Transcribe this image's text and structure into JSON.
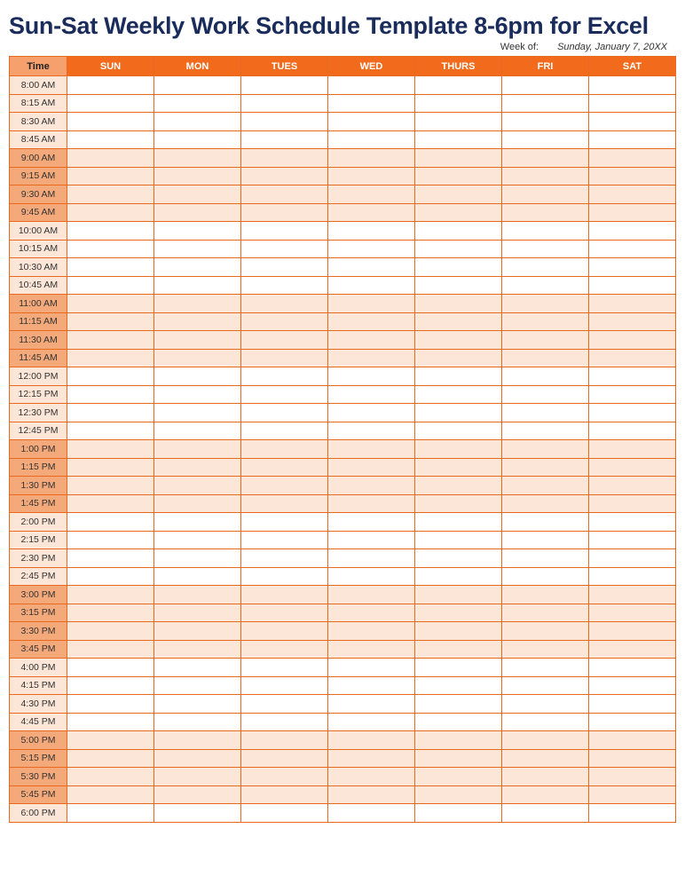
{
  "title": "Sun-Sat Weekly Work Schedule Template 8-6pm for Excel",
  "week_of_label": "Week of:",
  "week_of_value": "Sunday, January 7, 20XX",
  "headers": [
    "Time",
    "SUN",
    "MON",
    "TUES",
    "WED",
    "THURS",
    "FRI",
    "SAT"
  ],
  "rows": [
    {
      "time": "8:00 AM",
      "shade": "A",
      "cells": [
        "",
        "",
        "",
        "",
        "",
        "",
        ""
      ]
    },
    {
      "time": "8:15 AM",
      "shade": "A",
      "cells": [
        "",
        "",
        "",
        "",
        "",
        "",
        ""
      ]
    },
    {
      "time": "8:30 AM",
      "shade": "A",
      "cells": [
        "",
        "",
        "",
        "",
        "",
        "",
        ""
      ]
    },
    {
      "time": "8:45 AM",
      "shade": "A",
      "cells": [
        "",
        "",
        "",
        "",
        "",
        "",
        ""
      ]
    },
    {
      "time": "9:00 AM",
      "shade": "B",
      "cells": [
        "",
        "",
        "",
        "",
        "",
        "",
        ""
      ]
    },
    {
      "time": "9:15 AM",
      "shade": "B",
      "cells": [
        "",
        "",
        "",
        "",
        "",
        "",
        ""
      ]
    },
    {
      "time": "9:30 AM",
      "shade": "B",
      "cells": [
        "",
        "",
        "",
        "",
        "",
        "",
        ""
      ]
    },
    {
      "time": "9:45 AM",
      "shade": "B",
      "cells": [
        "",
        "",
        "",
        "",
        "",
        "",
        ""
      ]
    },
    {
      "time": "10:00 AM",
      "shade": "A",
      "cells": [
        "",
        "",
        "",
        "",
        "",
        "",
        ""
      ]
    },
    {
      "time": "10:15 AM",
      "shade": "A",
      "cells": [
        "",
        "",
        "",
        "",
        "",
        "",
        ""
      ]
    },
    {
      "time": "10:30 AM",
      "shade": "A",
      "cells": [
        "",
        "",
        "",
        "",
        "",
        "",
        ""
      ]
    },
    {
      "time": "10:45 AM",
      "shade": "A",
      "cells": [
        "",
        "",
        "",
        "",
        "",
        "",
        ""
      ]
    },
    {
      "time": "11:00 AM",
      "shade": "B",
      "cells": [
        "",
        "",
        "",
        "",
        "",
        "",
        ""
      ]
    },
    {
      "time": "11:15 AM",
      "shade": "B",
      "cells": [
        "",
        "",
        "",
        "",
        "",
        "",
        ""
      ]
    },
    {
      "time": "11:30 AM",
      "shade": "B",
      "cells": [
        "",
        "",
        "",
        "",
        "",
        "",
        ""
      ]
    },
    {
      "time": "11:45 AM",
      "shade": "B",
      "cells": [
        "",
        "",
        "",
        "",
        "",
        "",
        ""
      ]
    },
    {
      "time": "12:00 PM",
      "shade": "A",
      "cells": [
        "",
        "",
        "",
        "",
        "",
        "",
        ""
      ]
    },
    {
      "time": "12:15 PM",
      "shade": "A",
      "cells": [
        "",
        "",
        "",
        "",
        "",
        "",
        ""
      ]
    },
    {
      "time": "12:30 PM",
      "shade": "A",
      "cells": [
        "",
        "",
        "",
        "",
        "",
        "",
        ""
      ]
    },
    {
      "time": "12:45 PM",
      "shade": "A",
      "cells": [
        "",
        "",
        "",
        "",
        "",
        "",
        ""
      ]
    },
    {
      "time": "1:00 PM",
      "shade": "B",
      "cells": [
        "",
        "",
        "",
        "",
        "",
        "",
        ""
      ]
    },
    {
      "time": "1:15 PM",
      "shade": "B",
      "cells": [
        "",
        "",
        "",
        "",
        "",
        "",
        ""
      ]
    },
    {
      "time": "1:30 PM",
      "shade": "B",
      "cells": [
        "",
        "",
        "",
        "",
        "",
        "",
        ""
      ]
    },
    {
      "time": "1:45 PM",
      "shade": "B",
      "cells": [
        "",
        "",
        "",
        "",
        "",
        "",
        ""
      ]
    },
    {
      "time": "2:00 PM",
      "shade": "A",
      "cells": [
        "",
        "",
        "",
        "",
        "",
        "",
        ""
      ]
    },
    {
      "time": "2:15 PM",
      "shade": "A",
      "cells": [
        "",
        "",
        "",
        "",
        "",
        "",
        ""
      ]
    },
    {
      "time": "2:30 PM",
      "shade": "A",
      "cells": [
        "",
        "",
        "",
        "",
        "",
        "",
        ""
      ]
    },
    {
      "time": "2:45 PM",
      "shade": "A",
      "cells": [
        "",
        "",
        "",
        "",
        "",
        "",
        ""
      ]
    },
    {
      "time": "3:00 PM",
      "shade": "B",
      "cells": [
        "",
        "",
        "",
        "",
        "",
        "",
        ""
      ]
    },
    {
      "time": "3:15 PM",
      "shade": "B",
      "cells": [
        "",
        "",
        "",
        "",
        "",
        "",
        ""
      ]
    },
    {
      "time": "3:30 PM",
      "shade": "B",
      "cells": [
        "",
        "",
        "",
        "",
        "",
        "",
        ""
      ]
    },
    {
      "time": "3:45 PM",
      "shade": "B",
      "cells": [
        "",
        "",
        "",
        "",
        "",
        "",
        ""
      ]
    },
    {
      "time": "4:00 PM",
      "shade": "A",
      "cells": [
        "",
        "",
        "",
        "",
        "",
        "",
        ""
      ]
    },
    {
      "time": "4:15 PM",
      "shade": "A",
      "cells": [
        "",
        "",
        "",
        "",
        "",
        "",
        ""
      ]
    },
    {
      "time": "4:30 PM",
      "shade": "A",
      "cells": [
        "",
        "",
        "",
        "",
        "",
        "",
        ""
      ]
    },
    {
      "time": "4:45 PM",
      "shade": "A",
      "cells": [
        "",
        "",
        "",
        "",
        "",
        "",
        ""
      ]
    },
    {
      "time": "5:00 PM",
      "shade": "B",
      "cells": [
        "",
        "",
        "",
        "",
        "",
        "",
        ""
      ]
    },
    {
      "time": "5:15 PM",
      "shade": "B",
      "cells": [
        "",
        "",
        "",
        "",
        "",
        "",
        ""
      ]
    },
    {
      "time": "5:30 PM",
      "shade": "B",
      "cells": [
        "",
        "",
        "",
        "",
        "",
        "",
        ""
      ]
    },
    {
      "time": "5:45 PM",
      "shade": "B",
      "cells": [
        "",
        "",
        "",
        "",
        "",
        "",
        ""
      ]
    },
    {
      "time": "6:00 PM",
      "shade": "A",
      "cells": [
        "",
        "",
        "",
        "",
        "",
        "",
        ""
      ]
    }
  ]
}
